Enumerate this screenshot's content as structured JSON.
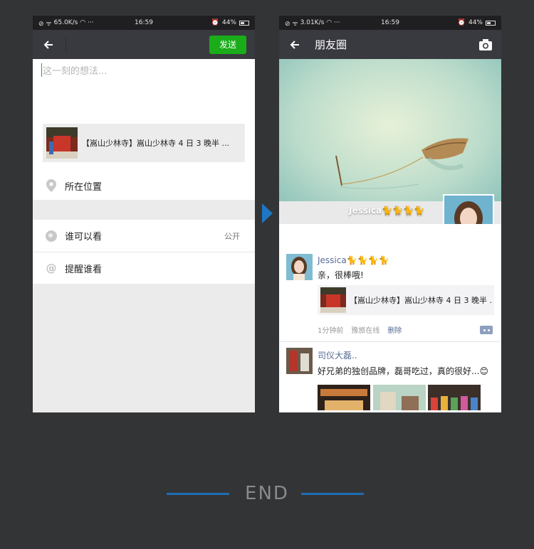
{
  "left_phone": {
    "status": {
      "network": "65.0K/s",
      "time": "16:59",
      "battery": "44%"
    },
    "send_label": "发送",
    "compose_placeholder": "这一刻的想法...",
    "share_card_text": "【嵩山少林寺】嵩山少林寺 4 日 3 晚半 ...",
    "location_label": "所在位置",
    "visibility_label": "谁可以看",
    "visibility_value": "公开",
    "mention_label": "提醒谁看"
  },
  "right_phone": {
    "status": {
      "network": "3.01K/s",
      "time": "16:59",
      "battery": "44%"
    },
    "title": "朋友圈",
    "cover_name": "Jessica🐈🐈🐈🐈",
    "posts": [
      {
        "name": "Jessica🐈🐈🐈🐈",
        "text": "亲，很棒哦!",
        "link_text": "【嵩山少林寺】嵩山少林寺 4 日 3 晚半 ...",
        "time": "1分钟前",
        "source": "豫旅在线",
        "delete": "删除"
      },
      {
        "name": "司仪大磊..",
        "text": "好兄弟的独创品牌，磊哥吃过，真的很好...😊"
      }
    ]
  },
  "footer": {
    "end_label": "END"
  },
  "colors": {
    "accent_green": "#1aad19",
    "link_blue": "#576b95",
    "end_blue": "#1d6eb3"
  }
}
